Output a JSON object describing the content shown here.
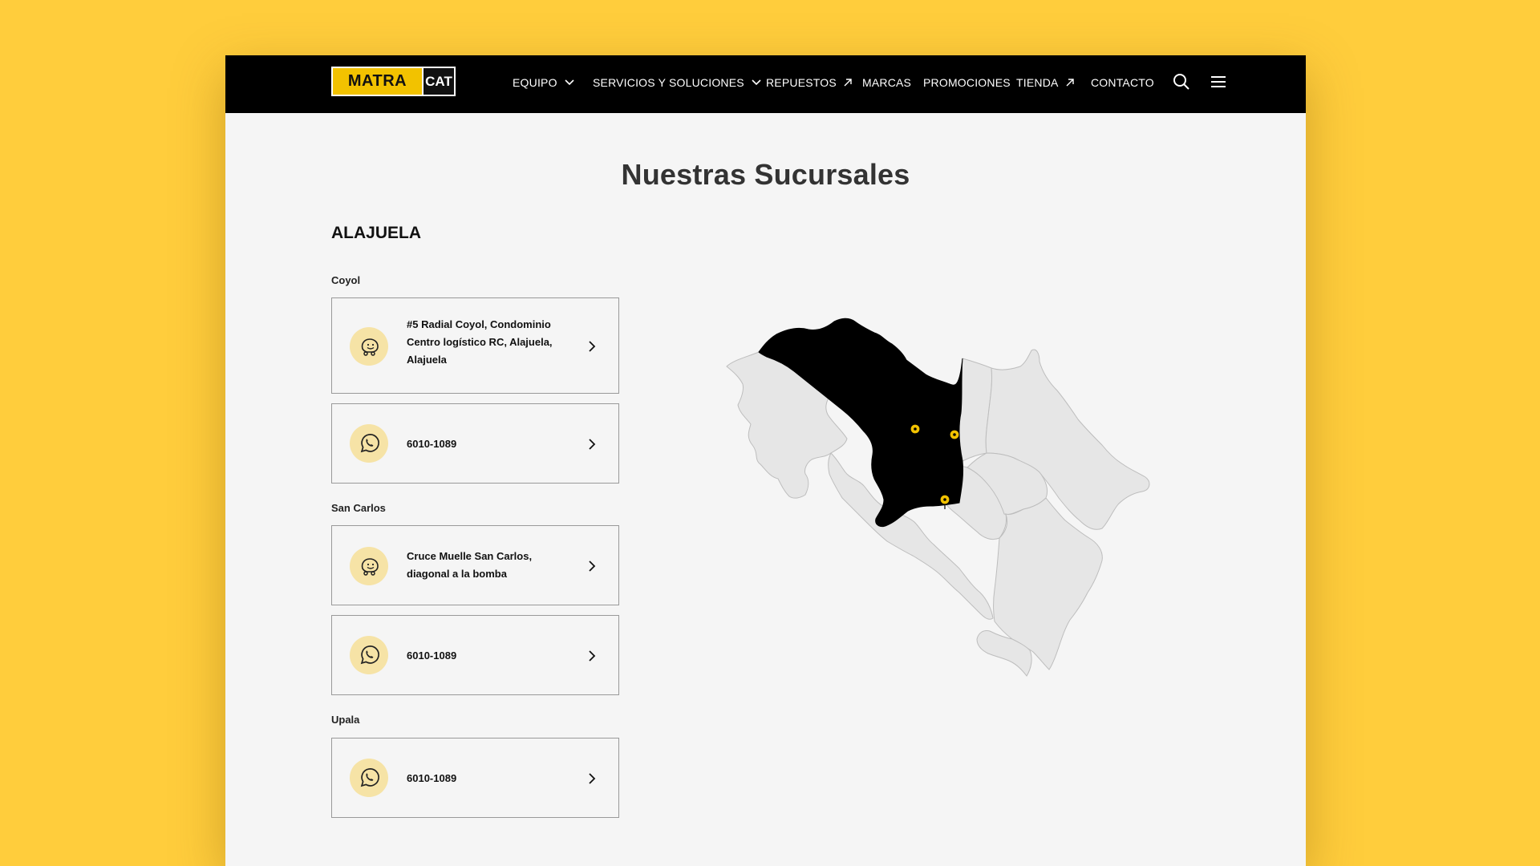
{
  "brand": {
    "logo_text": "MATRA",
    "logo_cat": "CAT",
    "accent": "#FFCD3C",
    "logo_yellow": "#F2C200",
    "nav_bg": "#000000"
  },
  "nav": {
    "items": [
      {
        "label": "EQUIPO",
        "icon": "chevron-down-icon"
      },
      {
        "label": "SERVICIOS Y SOLUCIONES",
        "icon": "chevron-down-icon"
      },
      {
        "label": "REPUESTOS",
        "icon": "external-arrow-icon"
      },
      {
        "label": "MARCAS"
      },
      {
        "label": "PROMOCIONES"
      },
      {
        "label": "TIENDA",
        "icon": "external-arrow-icon"
      },
      {
        "label": "CONTACTO"
      }
    ],
    "search_icon": "search-icon",
    "menu_icon": "hamburger-menu-icon"
  },
  "page": {
    "title": "Nuestras Sucursales",
    "region": "ALAJUELA"
  },
  "branches": [
    {
      "name": "Coyol",
      "cards": [
        {
          "icon": "waze-icon",
          "lines": [
            "#5 Radial Coyol, Condominio",
            "Centro logístico RC, Alajuela,",
            "Alajuela"
          ]
        },
        {
          "icon": "whatsapp-icon",
          "lines": [
            "6010-1089"
          ]
        }
      ]
    },
    {
      "name": "San Carlos",
      "cards": [
        {
          "icon": "waze-icon",
          "lines": [
            "Cruce Muelle San Carlos,",
            "diagonal a la bomba"
          ]
        },
        {
          "icon": "whatsapp-icon",
          "lines": [
            "6010-1089"
          ]
        }
      ]
    },
    {
      "name": "Upala",
      "cards": [
        {
          "icon": "whatsapp-icon",
          "lines": [
            "6010-1089"
          ]
        }
      ]
    }
  ],
  "map": {
    "highlighted_province": "Alajuela",
    "highlight_color": "#000000",
    "province_fill": "#E6E6E6",
    "marker_color": "#F2C200",
    "marker_count": 3
  }
}
